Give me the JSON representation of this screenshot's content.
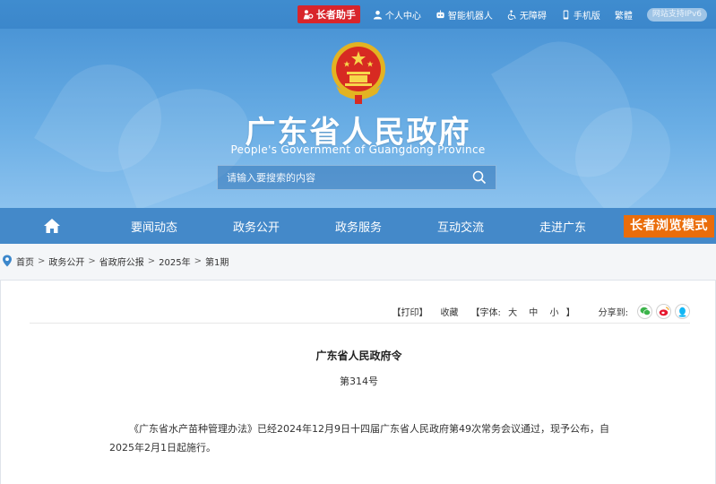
{
  "topbar": {
    "elder_helper": "长者助手",
    "links": [
      {
        "label": "个人中心",
        "icon": "person-icon"
      },
      {
        "label": "智能机器人",
        "icon": "robot-icon"
      },
      {
        "label": "无障碍",
        "icon": "accessibility-icon"
      },
      {
        "label": "手机版",
        "icon": "mobile-icon"
      },
      {
        "label": "繁體",
        "icon": ""
      }
    ],
    "ipv6": "网站支持IPv6"
  },
  "banner": {
    "title": "广东省人民政府",
    "subtitle": "People's Government of Guangdong Province",
    "search_placeholder": "请输入要搜索的内容"
  },
  "nav": {
    "items": [
      "要闻动态",
      "政务公开",
      "政务服务",
      "互动交流",
      "走进广东"
    ],
    "elder_mode": "长者浏览模式"
  },
  "breadcrumb": [
    "首页",
    "政务公开",
    "省政府公报",
    "2025年",
    "第1期"
  ],
  "toolbar": {
    "print": "【打印】",
    "favorite": "收藏",
    "font_prefix": "【字体:",
    "font_large": "大",
    "font_medium": "中",
    "font_small": "小",
    "font_suffix": "】",
    "share": "分享到:"
  },
  "document": {
    "title": "广东省人民政府令",
    "number": "第314号",
    "body": "《广东省水产苗种管理办法》已经2024年12月9日十四届广东省人民政府第49次常务会议通过，现予公布，自2025年2月1日起施行。"
  },
  "colors": {
    "topbar": "#3c87cb",
    "nav": "#4489c9",
    "elder_red": "#d8252b",
    "elder_orange": "#ea6d0b"
  }
}
